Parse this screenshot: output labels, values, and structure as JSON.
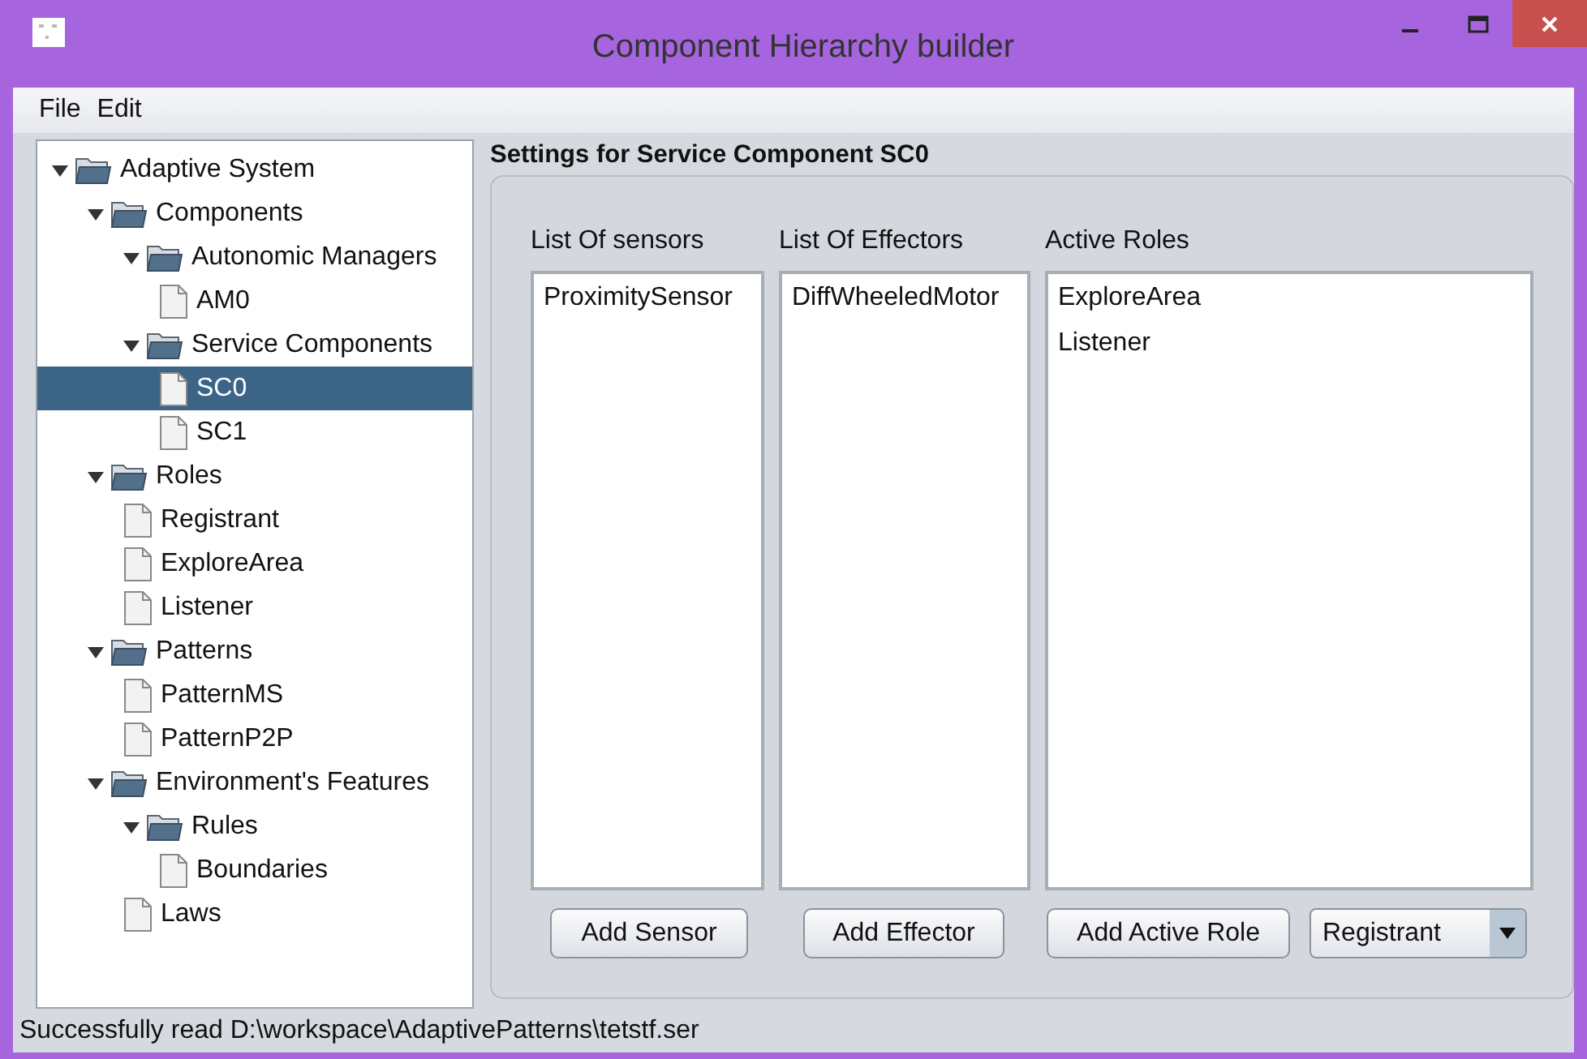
{
  "window": {
    "title": "Component Hierarchy builder"
  },
  "menu": [
    "File",
    "Edit"
  ],
  "tree": [
    {
      "label": "Adaptive System",
      "kind": "folder",
      "expanded": true,
      "selected": false,
      "children": [
        {
          "label": "Components",
          "kind": "folder",
          "expanded": true,
          "selected": false,
          "children": [
            {
              "label": "Autonomic Managers",
              "kind": "folder",
              "expanded": true,
              "selected": false,
              "children": [
                {
                  "label": "AM0",
                  "kind": "file",
                  "selected": false
                }
              ]
            },
            {
              "label": "Service Components",
              "kind": "folder",
              "expanded": true,
              "selected": false,
              "children": [
                {
                  "label": "SC0",
                  "kind": "file",
                  "selected": true
                },
                {
                  "label": "SC1",
                  "kind": "file",
                  "selected": false
                }
              ]
            }
          ]
        },
        {
          "label": "Roles",
          "kind": "folder",
          "expanded": true,
          "selected": false,
          "children": [
            {
              "label": "Registrant",
              "kind": "file",
              "selected": false
            },
            {
              "label": "ExploreArea",
              "kind": "file",
              "selected": false
            },
            {
              "label": "Listener",
              "kind": "file",
              "selected": false
            }
          ]
        },
        {
          "label": "Patterns",
          "kind": "folder",
          "expanded": true,
          "selected": false,
          "children": [
            {
              "label": "PatternMS",
              "kind": "file",
              "selected": false
            },
            {
              "label": "PatternP2P",
              "kind": "file",
              "selected": false
            }
          ]
        },
        {
          "label": "Environment's Features",
          "kind": "folder",
          "expanded": true,
          "selected": false,
          "children": [
            {
              "label": "Rules",
              "kind": "folder",
              "expanded": true,
              "selected": false,
              "children": [
                {
                  "label": "Boundaries",
                  "kind": "file",
                  "selected": false
                }
              ]
            },
            {
              "label": "Laws",
              "kind": "file",
              "selected": false
            }
          ]
        }
      ]
    }
  ],
  "settings": {
    "title": "Settings for Service Component SC0",
    "lists": [
      {
        "label": "List Of sensors",
        "items": [
          "ProximitySensor"
        ],
        "button": "Add Sensor"
      },
      {
        "label": "List Of Effectors",
        "items": [
          "DiffWheeledMotor"
        ],
        "button": "Add Effector"
      },
      {
        "label": "Active Roles",
        "items": [
          "ExploreArea",
          "Listener"
        ],
        "button": "Add Active Role"
      }
    ],
    "role_dropdown": {
      "value": "Registrant"
    }
  },
  "status_bar": "Successfully read D:\\workspace\\AdaptivePatterns\\tetstf.ser"
}
